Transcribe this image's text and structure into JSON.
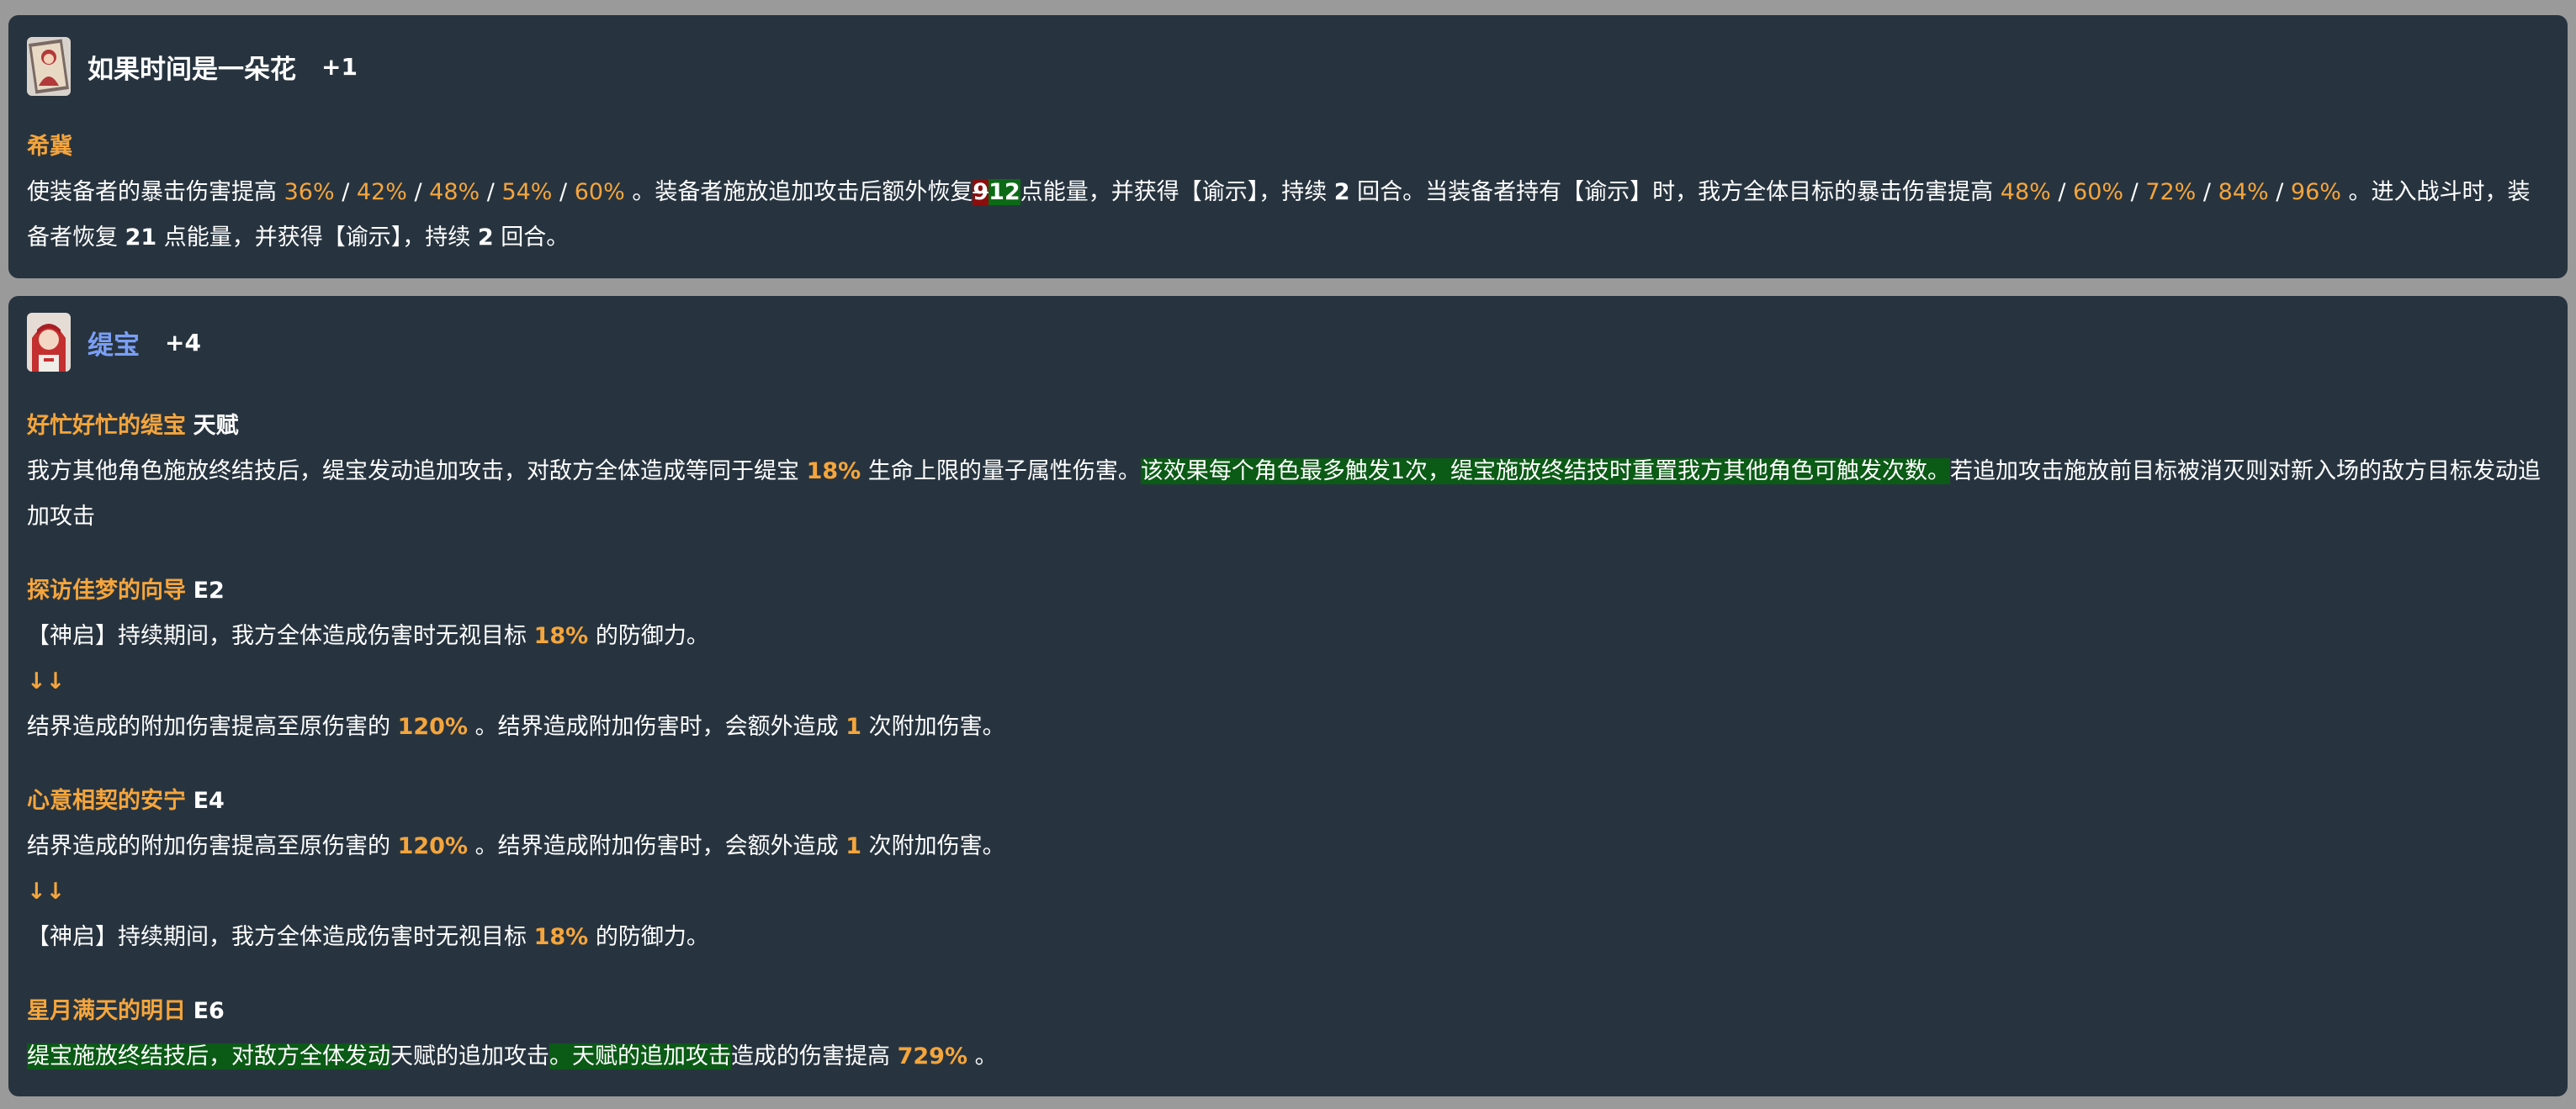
{
  "lightcone": {
    "name": "如果时间是一朵花",
    "rank": "+1",
    "skill_title": "希冀",
    "desc": {
      "p1": "使装备者的暴击伤害提高 ",
      "crit_values": [
        "36%",
        "42%",
        "48%",
        "54%",
        "60%"
      ],
      "sep": " / ",
      "p2": " 。装备者施放追加攻击后额外恢复",
      "old_energy": "9",
      "new_energy": "12",
      "p3": "点能量，并获得【谕示】，持续 ",
      "turns1": "2",
      "p4": " 回合。当装备者持有【谕示】时，我方全体目标的暴击伤害提高 ",
      "team_values": [
        "48%",
        "60%",
        "72%",
        "84%",
        "96%"
      ],
      "p5": " 。进入战斗时，装备者恢复 ",
      "energy_start": "21",
      "p6": " 点能量，并获得【谕示】，持续 ",
      "turns2": "2",
      "p7": " 回合。"
    }
  },
  "character": {
    "name": "缇宝",
    "rank": "+4",
    "name_color": "#7b9ff5",
    "talent": {
      "title": "好忙好忙的缇宝",
      "tag": "天赋",
      "t1": "我方其他角色施放终结技后，缇宝发动追加攻击，对敌方全体造成等同于缇宝 ",
      "value": "18%",
      "t2": " 生命上限的量子属性伤害。",
      "highlight": "该效果每个角色最多触发1次，缇宝施放终结技时重置我方其他角色可触发次数。",
      "t3": "若追加攻击施放前目标被消灭则对新入场的敌方目标发动追加攻击"
    },
    "e2": {
      "title": "探访佳梦的向导",
      "tag": "E2",
      "old_a": "【神启】持续期间，我方全体造成伤害时无视目标 ",
      "old_val": "18%",
      "old_b": " 的防御力。",
      "arrow": "↓↓",
      "new_a": "结界造成的附加伤害提高至原伤害的 ",
      "new_val": "120%",
      "new_b": " 。结界造成附加伤害时，会额外造成 ",
      "new_count": "1",
      "new_c": " 次附加伤害。"
    },
    "e4": {
      "title": "心意相契的安宁",
      "tag": "E4",
      "old_a": "结界造成的附加伤害提高至原伤害的 ",
      "old_val": "120%",
      "old_b": " 。结界造成附加伤害时，会额外造成 ",
      "old_count": "1",
      "old_c": " 次附加伤害。",
      "arrow": "↓↓",
      "new_a": "【神启】持续期间，我方全体造成伤害时无视目标 ",
      "new_val": "18%",
      "new_b": " 的防御力。"
    },
    "e6": {
      "title": "星月满天的明日",
      "tag": "E6",
      "hl1": "缇宝施放终结技后，对敌方全体发动",
      "plain1": "天赋的追加攻击",
      "hl2": "。天赋的追加攻击",
      "plain2": "造成的伤害提高 ",
      "value": "729%",
      "plain3": " 。"
    }
  }
}
